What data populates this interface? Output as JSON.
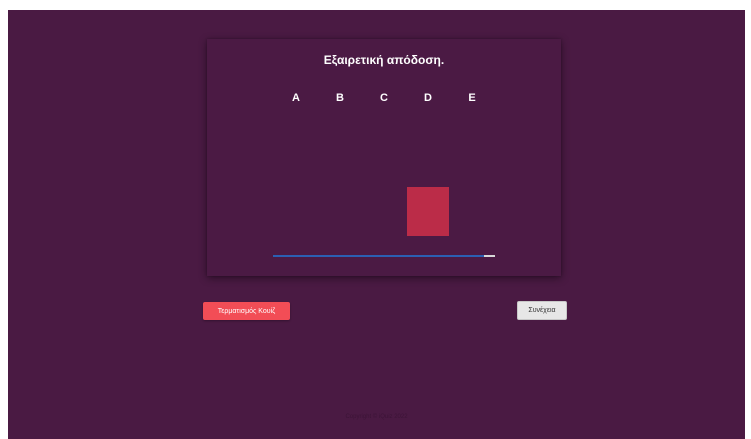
{
  "quiz": {
    "result_title": "Εξαιρετική απόδοση.",
    "options": [
      "A",
      "B",
      "C",
      "D",
      "E"
    ],
    "selected_option_index": 3,
    "progress_fraction": 0.95
  },
  "buttons": {
    "quit_label": "Τερματισμός Κουίζ",
    "continue_label": "Συνέχεια"
  },
  "footer": {
    "copyright": "Copyright © iQuiz 2022"
  },
  "colors": {
    "background": "#4a1a43",
    "answer_marker": "#bb2c48",
    "progress": "#2b5fb3",
    "quit_button": "#f24d56",
    "continue_button": "#e7e7e7"
  }
}
